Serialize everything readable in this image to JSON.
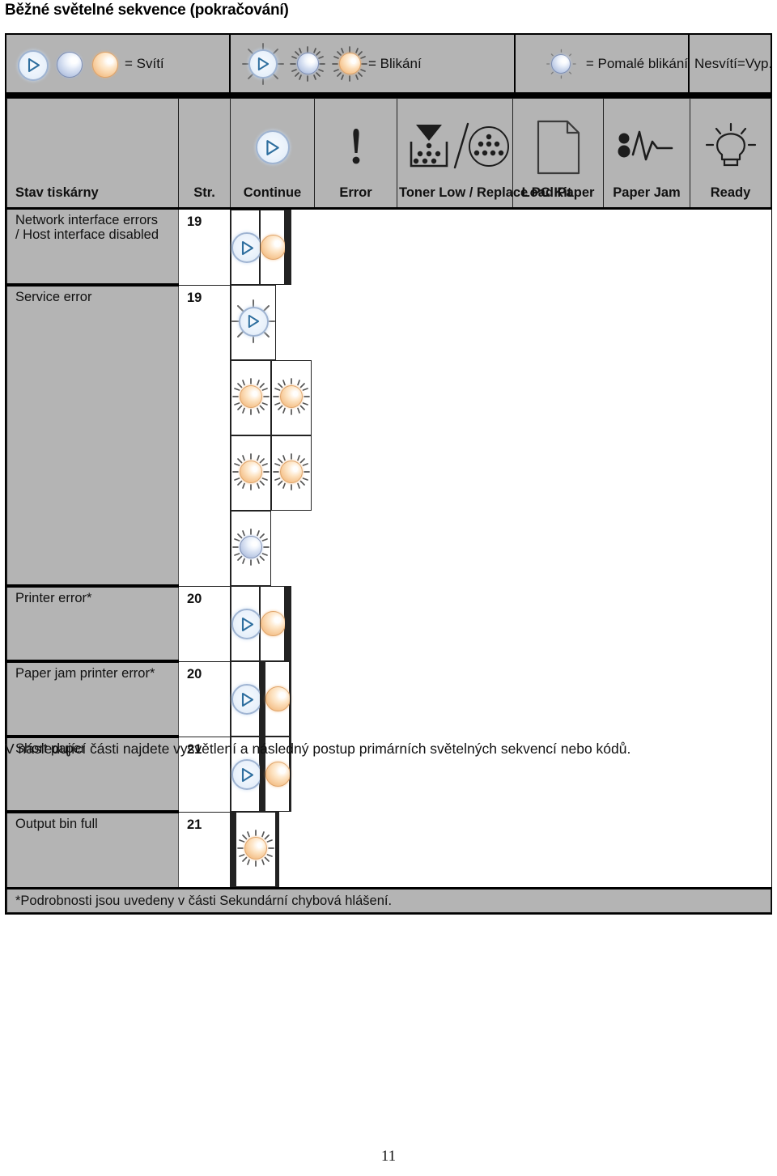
{
  "page_title": "Běžné světelné sekvence (pokračování)",
  "legend": [
    {
      "text": "= Svítí",
      "icons": [
        "play-on",
        "blue-on",
        "orange-on"
      ]
    },
    {
      "text": "= Blikání",
      "icons": [
        "play-blink",
        "blue-blink",
        "orange-blink"
      ]
    },
    {
      "text": "= Pomalé blikání",
      "icons": [
        "blue-slow-blink"
      ]
    },
    {
      "text": "Nesvítí=Vyp.",
      "icons": []
    }
  ],
  "table": {
    "columns": [
      {
        "label": "Stav  tiskárny",
        "icon": "none"
      },
      {
        "label": "Str.",
        "icon": "none"
      },
      {
        "label": "Continue",
        "icon": "play-icon"
      },
      {
        "label": "Error",
        "icon": "exclamation-icon"
      },
      {
        "label": "Toner Low /\nReplace PC Kit",
        "icon": "toner-icon"
      },
      {
        "label": "Load Paper",
        "icon": "paper-sheet-icon"
      },
      {
        "label": "Paper Jam",
        "icon": "paper-jam-icon"
      },
      {
        "label": "Ready",
        "icon": "lightbulb-icon"
      }
    ],
    "rows": [
      {
        "state": "Network interface errors\n/ Host interface disabled",
        "page": "19",
        "lamps": [
          "play-on",
          "orange-on",
          "",
          "",
          "",
          ""
        ]
      },
      {
        "state": "Service error",
        "page": "19",
        "lamps": [
          "play-blink",
          "orange-blink",
          "orange-blink",
          "orange-blink",
          "orange-blink",
          "blue-blink"
        ]
      },
      {
        "state": "Printer error*",
        "page": "20",
        "lamps": [
          "play-on",
          "orange-on",
          "",
          "",
          "",
          ""
        ]
      },
      {
        "state": "Paper jam printer error*",
        "page": "20",
        "lamps": [
          "play-on",
          "",
          "",
          "",
          "orange-on",
          ""
        ]
      },
      {
        "state": "Short paper",
        "page": "21",
        "lamps": [
          "play-on",
          "",
          "",
          "",
          "orange-on",
          ""
        ]
      },
      {
        "state": "Output bin full",
        "page": "21",
        "lamps": [
          "",
          "",
          "",
          "orange-blink",
          "",
          ""
        ]
      }
    ],
    "footnote": "*Podrobnosti jsou uvedeny v části Sekundární chybová hlášení."
  },
  "body_paragraph": "V následující části najdete vysvětlení a následný postup primárních světelných sekvencí nebo kódů.",
  "page_number": "11",
  "colors": {
    "panel_gray": "#b4b4b4",
    "rule_black": "#000000",
    "lamp_orange": "#f3c08a",
    "lamp_blue": "#b9c8e2",
    "play_blue": "#2f6f9f"
  }
}
